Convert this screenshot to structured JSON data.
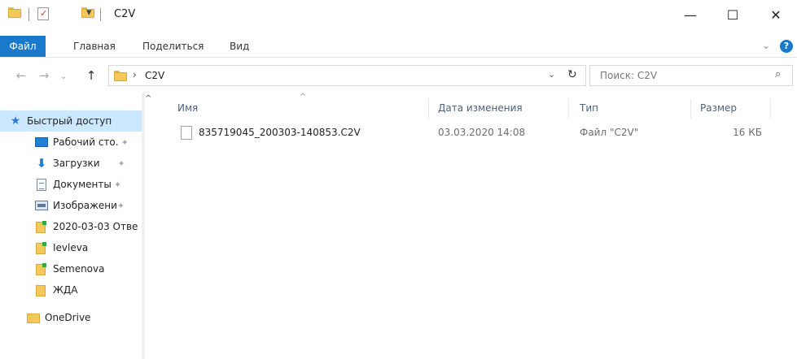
{
  "window": {
    "title": "C2V",
    "minimize_label": "—",
    "maximize_label": "☐",
    "close_label": "✕",
    "qa_dropdown": "▾"
  },
  "ribbon": {
    "tabs": [
      "Файл",
      "Главная",
      "Поделиться",
      "Вид"
    ],
    "expand_chevron": "⌄",
    "help_label": "?"
  },
  "address": {
    "back": "←",
    "forward": "→",
    "recent": "⌄",
    "up": "↑",
    "separator": "›",
    "path": "C2V",
    "dropdown": "⌄",
    "refresh": "↻"
  },
  "search": {
    "placeholder": "Поиск: C2V",
    "icon": "⌕"
  },
  "nav": {
    "scroll_up": "^",
    "pin_glyph": "✦",
    "items": [
      {
        "label": "Быстрый доступ",
        "icon": "star-icon",
        "pinned": false
      },
      {
        "label": "Рабочий сто.",
        "icon": "desktop-icon",
        "pinned": true
      },
      {
        "label": "Загрузки",
        "icon": "downloads-icon",
        "pinned": true
      },
      {
        "label": "Документы",
        "icon": "documents-icon",
        "pinned": true
      },
      {
        "label": "Изображени",
        "icon": "pictures-icon",
        "pinned": true
      },
      {
        "label": "2020-03-03 Отве",
        "icon": "folder-icon",
        "pinned": false
      },
      {
        "label": "Ievleva",
        "icon": "folder-icon",
        "pinned": false
      },
      {
        "label": "Semenova",
        "icon": "folder-icon",
        "pinned": false
      },
      {
        "label": "ЖДА",
        "icon": "folder-icon",
        "pinned": false
      },
      {
        "label": "OneDrive",
        "icon": "onedrive-folder-icon",
        "pinned": false
      }
    ]
  },
  "columns": {
    "name": "Имя",
    "date": "Дата изменения",
    "type": "Тип",
    "size": "Размер",
    "sort_indicator": "^"
  },
  "files": [
    {
      "name": "835719045_200303-140853.C2V",
      "date": "03.03.2020 14:08",
      "type": "Файл \"C2V\"",
      "size": "16 КБ"
    }
  ]
}
